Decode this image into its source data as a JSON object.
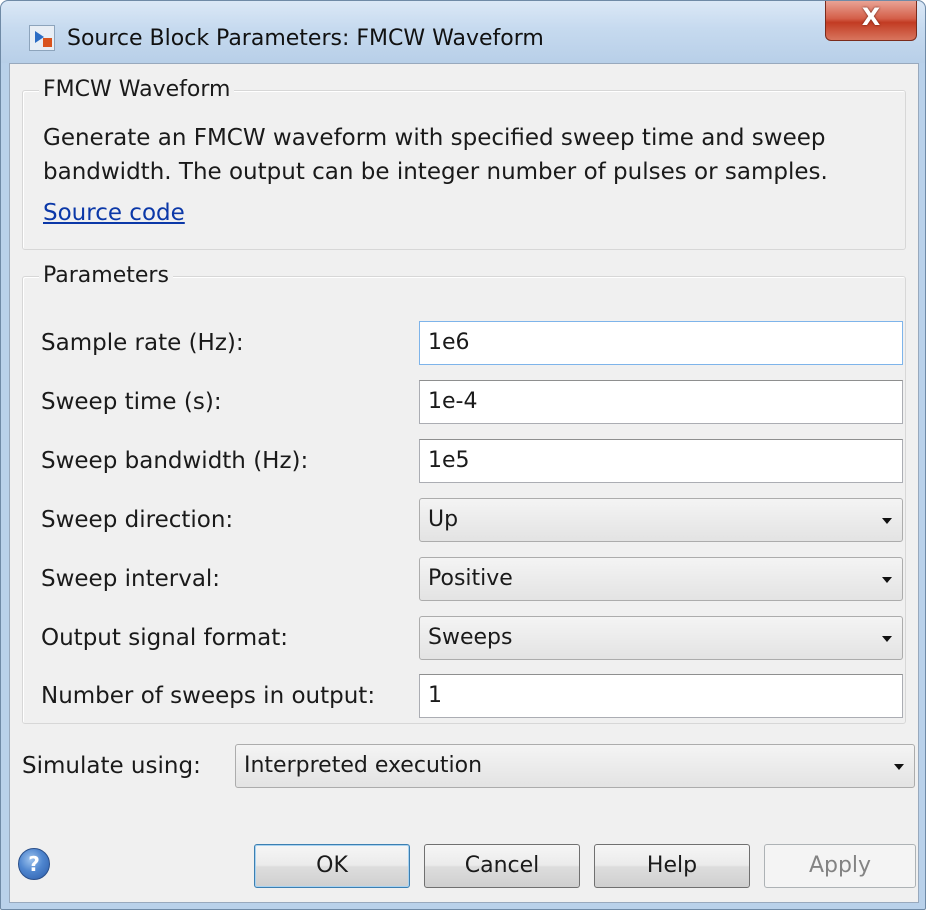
{
  "window": {
    "title": "Source Block Parameters: FMCW Waveform",
    "close_glyph": "X",
    "app_icon": "simulink-block-icon"
  },
  "description_group": {
    "title": "FMCW Waveform",
    "line1": "Generate an FMCW waveform with specified sweep time and sweep",
    "line2": "bandwidth. The output can be integer number of pulses or samples.",
    "link": "Source code"
  },
  "parameters": {
    "title": "Parameters",
    "sample_rate": {
      "label": "Sample rate (Hz):",
      "value": "1e6"
    },
    "sweep_time": {
      "label": "Sweep time (s):",
      "value": "1e-4"
    },
    "sweep_bandwidth": {
      "label": "Sweep bandwidth (Hz):",
      "value": "1e5"
    },
    "sweep_direction": {
      "label": "Sweep direction:",
      "value": "Up"
    },
    "sweep_interval": {
      "label": "Sweep interval:",
      "value": "Positive"
    },
    "output_signal_format": {
      "label": "Output signal format:",
      "value": "Sweeps"
    },
    "number_of_sweeps": {
      "label": "Number of sweeps in output:",
      "value": "1"
    }
  },
  "simulate": {
    "label": "Simulate using:",
    "value": "Interpreted execution"
  },
  "buttons": {
    "ok": "OK",
    "cancel": "Cancel",
    "help": "Help",
    "apply": "Apply",
    "help_icon_glyph": "?"
  }
}
